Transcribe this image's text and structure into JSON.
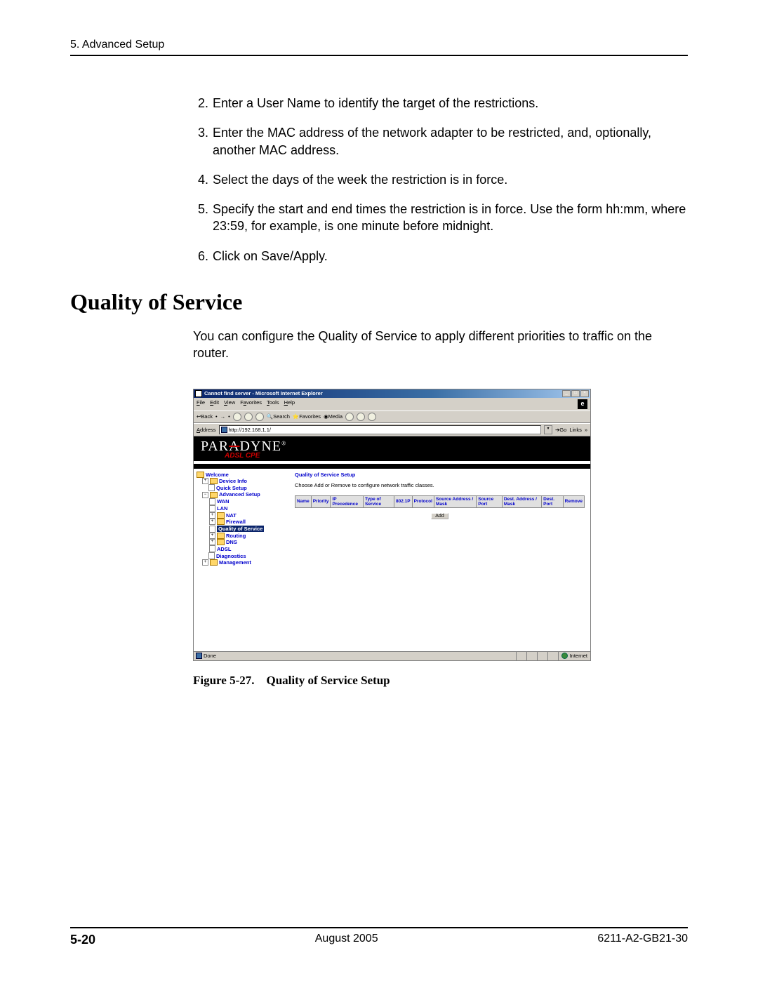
{
  "header": {
    "chapter": "5. Advanced Setup"
  },
  "steps": [
    {
      "num": "2.",
      "text": "Enter a User Name to identify the target of the restrictions."
    },
    {
      "num": "3.",
      "text": "Enter the MAC address of the network adapter to be restricted, and, optionally, another MAC address."
    },
    {
      "num": "4.",
      "text": "Select the days of the week the restriction is in force."
    },
    {
      "num": "5.",
      "text": "Specify the start and end times the restriction is in force. Use the form hh:mm, where 23:59, for example, is one minute before midnight."
    },
    {
      "num": "6.",
      "text": "Click on Save/Apply."
    }
  ],
  "section_heading": "Quality of Service",
  "qos_intro": "You can configure the Quality of Service to apply different priorities to traffic on the router.",
  "ie": {
    "title": "Cannot find server - Microsoft Internet Explorer",
    "menus": {
      "file": "File",
      "edit": "Edit",
      "view": "View",
      "favorites": "Favorites",
      "tools": "Tools",
      "help": "Help"
    },
    "toolbar": {
      "back": "Back",
      "search": "Search",
      "favorites": "Favorites",
      "media": "Media"
    },
    "addressbar": {
      "label": "Address",
      "value": "http://192.168.1.1/",
      "go": "Go",
      "links": "Links"
    },
    "banner": {
      "logo_l": "PAR",
      "logo_a": "A",
      "logo_r": "DYNE",
      "reg": "®",
      "sub": "ADSL CPE"
    },
    "tree": {
      "welcome": "Welcome",
      "device_info": "Device Info",
      "quick_setup": "Quick Setup",
      "advanced_setup": "Advanced Setup",
      "wan": "WAN",
      "lan": "LAN",
      "nat": "NAT",
      "firewall": "Firewall",
      "qos": "Quality of Service",
      "routing": "Routing",
      "dns": "DNS",
      "adsl": "ADSL",
      "diagnostics": "Diagnostics",
      "management": "Management"
    },
    "pane": {
      "title": "Quality of Service Setup",
      "sub": "Choose Add or Remove to configure network traffic classes.",
      "cols": {
        "name": "Name",
        "priority": "Priority",
        "ip_prec": "IP Precedence",
        "tos": "Type of Service",
        "p8021": "802.1P",
        "protocol": "Protocol",
        "src_addr": "Source Address / Mask",
        "src_port": "Source Port",
        "dst_addr": "Dest. Address / Mask",
        "dst_port": "Dest. Port",
        "remove": "Remove"
      },
      "add_btn": "Add"
    },
    "status": {
      "done": "Done",
      "zone": "Internet"
    }
  },
  "figure_caption": "Figure 5-27. Quality of Service Setup",
  "footer": {
    "page": "5-20",
    "date": "August 2005",
    "docnum": "6211-A2-GB21-30"
  }
}
